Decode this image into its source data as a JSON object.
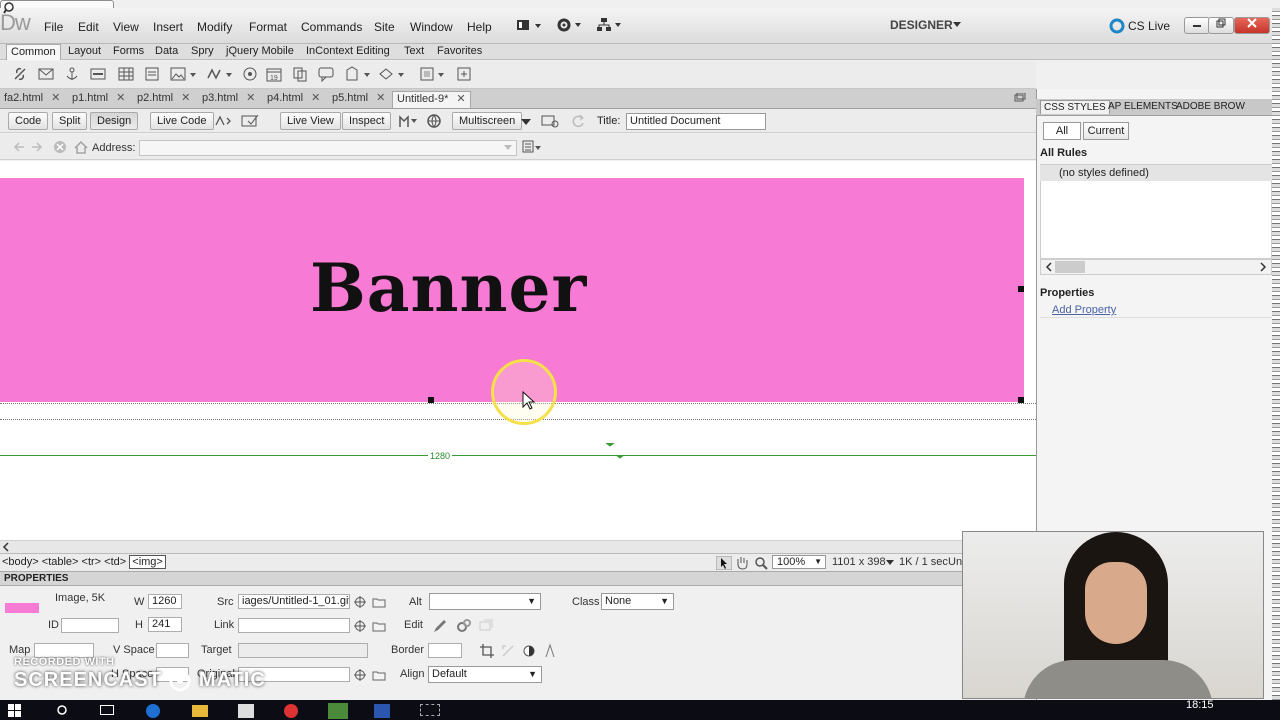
{
  "menubar": {
    "logo": "Dw",
    "items": [
      "File",
      "Edit",
      "View",
      "Insert",
      "Modify",
      "Format",
      "Commands",
      "Site",
      "Window",
      "Help"
    ],
    "workspace": "DESIGNER",
    "cs_live": "CS Live"
  },
  "insert_tabs": [
    "Common",
    "Layout",
    "Forms",
    "Data",
    "Spry",
    "jQuery Mobile",
    "InContext Editing",
    "Text",
    "Favorites"
  ],
  "doc_tabs": [
    "fa2.html",
    "p1.html",
    "p2.html",
    "p3.html",
    "p4.html",
    "p5.html",
    "Untitled-9*"
  ],
  "doc_toolbar": {
    "code": "Code",
    "split": "Split",
    "design": "Design",
    "live_code": "Live Code",
    "live_view": "Live View",
    "inspect": "Inspect",
    "multiscreen": "Multiscreen",
    "title_label": "Title:",
    "title_value": "Untitled Document",
    "address_label": "Address:"
  },
  "design": {
    "banner_text": "Banner",
    "ruler_label": "1280",
    "banner_color": "#f77ad5"
  },
  "status": {
    "tags": [
      "<body>",
      "<table>",
      "<tr>",
      "<td>",
      "<img>"
    ],
    "zoom": "100%",
    "size": "1101 x 398",
    "download": "1K / 1 sec",
    "encoding": "Un"
  },
  "properties": {
    "header": "PROPERTIES",
    "image_label": "Image, 5K",
    "w_label": "W",
    "w_value": "1260",
    "h_label": "H",
    "h_value": "241",
    "id_label": "ID",
    "src_label": "Src",
    "src_value": "iages/Untitled-1_01.gif",
    "link_label": "Link",
    "alt_label": "Alt",
    "edit_label": "Edit",
    "class_label": "Class",
    "class_value": "None",
    "map_label": "Map",
    "vspace_label": "V Space",
    "hspace_label": "H Space",
    "target_label": "Target",
    "original_label": "Original",
    "border_label": "Border",
    "align_label": "Align",
    "align_value": "Default"
  },
  "right_panel": {
    "tabs": [
      "CSS STYLES",
      "AP ELEMENTS",
      "ADOBE BROW"
    ],
    "all": "All",
    "current": "Current",
    "all_rules": "All Rules",
    "no_styles": "(no styles defined)",
    "properties": "Properties",
    "add_property": "Add Property"
  },
  "watermark": {
    "line1": "RECORDED WITH",
    "line2": "SCREENCAST",
    "line3": "MATIC"
  },
  "taskbar": {
    "clock": "18:15"
  }
}
